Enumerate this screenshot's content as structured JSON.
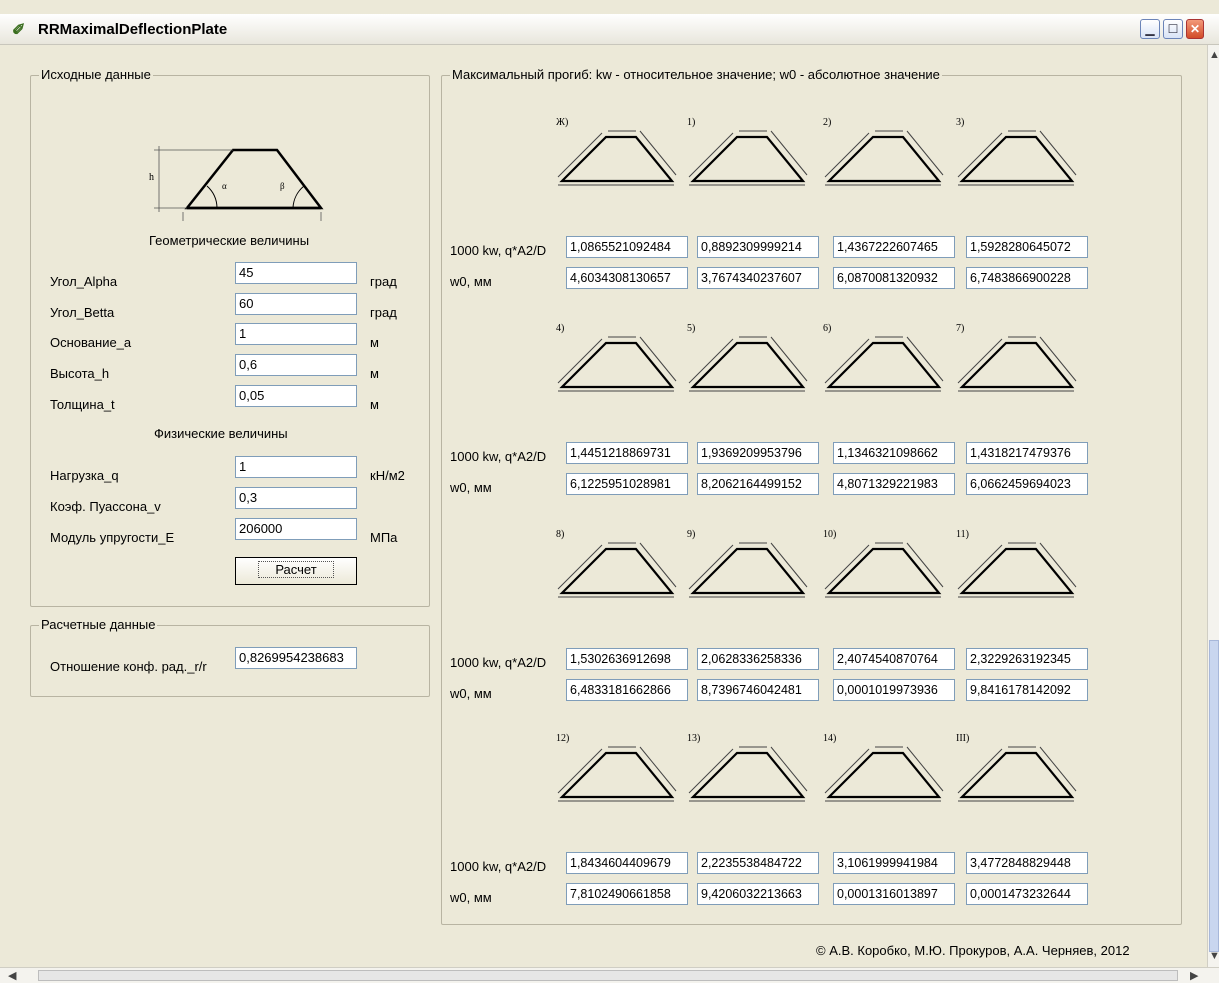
{
  "window": {
    "title": "RRMaximalDeflectionPlate"
  },
  "input": {
    "legend": "Исходные данные",
    "sketch_labels": {
      "h": "h",
      "a": "a",
      "alpha": "α",
      "beta": "β"
    },
    "geom_title": "Геометрические величины",
    "phys_title": "Физические величины",
    "rows": [
      {
        "label": "Угол_Alpha",
        "value": "45",
        "unit": "град"
      },
      {
        "label": "Угол_Betta",
        "value": "60",
        "unit": "град"
      },
      {
        "label": "Основание_a",
        "value": "1",
        "unit": "м"
      },
      {
        "label": "Высота_h",
        "value": "0,6",
        "unit": "м"
      },
      {
        "label": "Толщина_t",
        "value": "0,05",
        "unit": "м"
      },
      {
        "label": "Нагрузка_q",
        "value": "1",
        "unit": "кН/м2"
      },
      {
        "label": "Коэф. Пуассона_v",
        "value": "0,3",
        "unit": ""
      },
      {
        "label": "Модуль упругости_E",
        "value": "206000",
        "unit": "МПа"
      }
    ],
    "button": "Расчет"
  },
  "calc": {
    "legend": "Расчетные данные",
    "label": "Отношение конф. рад._r/r",
    "value": "0,8269954238683"
  },
  "results": {
    "legend": "Максимальный прогиб: kw - относительное значение; w0 - абсолютное значение",
    "kw_label": "1000 kw, q*A2/D",
    "w0_label": "w0, мм",
    "blocks": [
      {
        "cases": [
          "Ж)",
          "1)",
          "2)",
          "3)"
        ],
        "kw": [
          "1,0865521092484",
          "0,8892309999214",
          "1,4367222607465",
          "1,5928280645072"
        ],
        "w0": [
          "4,6034308130657",
          "3,7674340237607",
          "6,0870081320932",
          "6,7483866900228"
        ]
      },
      {
        "cases": [
          "4)",
          "5)",
          "6)",
          "7)"
        ],
        "kw": [
          "1,4451218869731",
          "1,9369209953796",
          "1,1346321098662",
          "1,4318217479376"
        ],
        "w0": [
          "6,1225951028981",
          "8,2062164499152",
          "4,8071329221983",
          "6,0662459694023"
        ]
      },
      {
        "cases": [
          "8)",
          "9)",
          "10)",
          "11)"
        ],
        "kw": [
          "1,5302636912698",
          "2,0628336258336",
          "2,4074540870764",
          "2,3229263192345"
        ],
        "w0": [
          "6,4833181662866",
          "8,7396746042481",
          "0,0001019973936",
          "9,8416178142092"
        ]
      },
      {
        "cases": [
          "12)",
          "13)",
          "14)",
          "III)"
        ],
        "kw": [
          "1,8434604409679",
          "2,2235538484722",
          "3,1061999941984",
          "3,4772848829448"
        ],
        "w0": [
          "7,8102490661858",
          "9,4206032213663",
          "0,0001316013897",
          "0,0001473232644"
        ]
      }
    ]
  },
  "footer": {
    "copyright": "© А.В. Коробко, М.Ю. Прокуров, А.А. Черняев, 2012"
  }
}
